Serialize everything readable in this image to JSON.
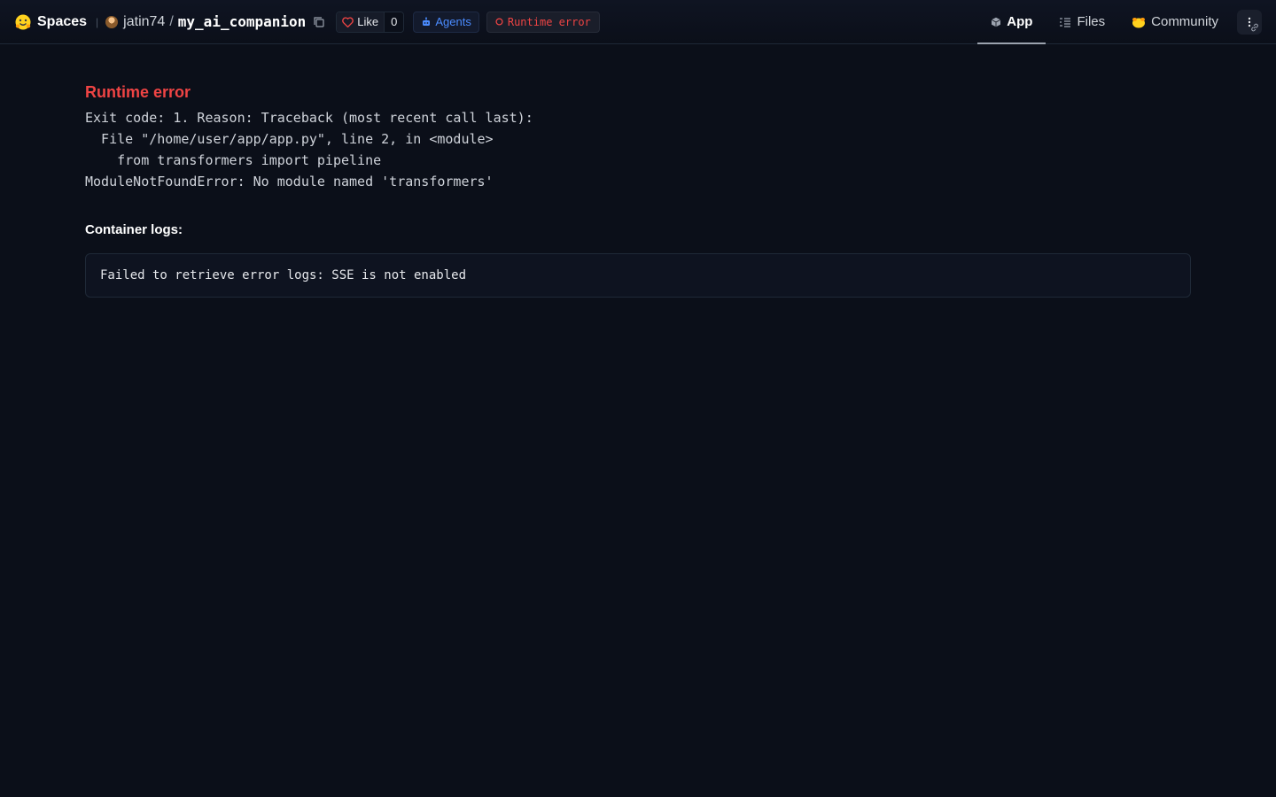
{
  "header": {
    "spaces_label": "Spaces",
    "owner": "jatin74",
    "slash": "/",
    "repo": "my_ai_companion",
    "like_label": "Like",
    "like_count": "0",
    "agents_label": "Agents",
    "status_label": "Runtime error",
    "status_color": "#ef4444"
  },
  "tabs": [
    {
      "label": "App",
      "icon": "cube-icon",
      "active": true
    },
    {
      "label": "Files",
      "icon": "files-icon",
      "active": false
    },
    {
      "label": "Community",
      "icon": "community-icon",
      "active": false
    }
  ],
  "error": {
    "title": "Runtime error",
    "traceback": "Exit code: 1. Reason: Traceback (most recent call last):\n  File \"/home/user/app/app.py\", line 2, in <module>\n    from transformers import pipeline\nModuleNotFoundError: No module named 'transformers'"
  },
  "logs": {
    "title": "Container logs:",
    "message": "Failed to retrieve error logs: SSE is not enabled"
  }
}
